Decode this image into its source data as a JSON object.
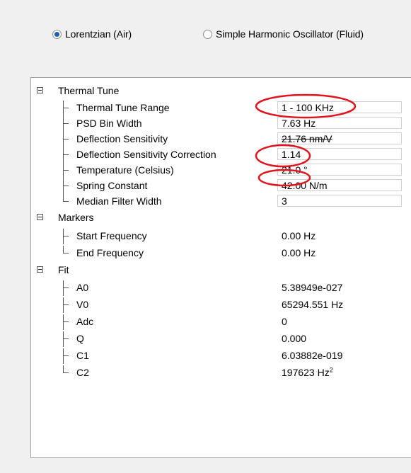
{
  "mode_selector": {
    "options": [
      {
        "label": "Lorentzian (Air)",
        "checked": true
      },
      {
        "label": "Simple Harmonic Oscillator (Fluid)",
        "checked": false
      }
    ]
  },
  "property_grid": {
    "groups": [
      {
        "label": "Thermal Tune",
        "expanded": true,
        "properties": [
          {
            "name": "Thermal Tune Range",
            "value": "1 - 100 KHz"
          },
          {
            "name": "PSD Bin Width",
            "value": "7.63 Hz"
          },
          {
            "name": "Deflection Sensitivity",
            "value": "21.76 nm/V"
          },
          {
            "name": "Deflection Sensitivity Correction",
            "value": "1.14"
          },
          {
            "name": "Temperature (Celsius)",
            "value": "21.0 °"
          },
          {
            "name": "Spring Constant",
            "value": "42.00 N/m"
          },
          {
            "name": "Median Filter Width",
            "value": "3"
          }
        ]
      },
      {
        "label": "Markers",
        "expanded": true,
        "properties": [
          {
            "name": "Start Frequency",
            "value": "0.00 Hz"
          },
          {
            "name": "End Frequency",
            "value": "0.00 Hz"
          }
        ]
      },
      {
        "label": "Fit",
        "expanded": true,
        "properties": [
          {
            "name": "A0",
            "value": "5.38949e-027"
          },
          {
            "name": "V0",
            "value": "65294.551 Hz"
          },
          {
            "name": "Adc",
            "value": "0"
          },
          {
            "name": "Q",
            "value": "0.000"
          },
          {
            "name": "C1",
            "value": "6.03882e-019"
          },
          {
            "name": "C2",
            "value": "197623 Hz",
            "superscript": "2"
          }
        ]
      }
    ]
  },
  "annotation_color": "#e0141e"
}
